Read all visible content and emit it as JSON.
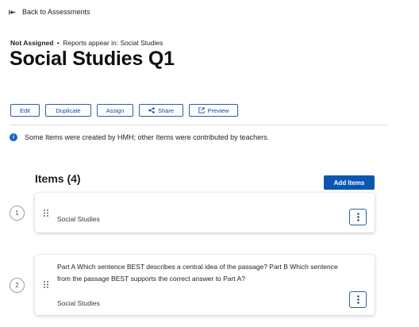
{
  "nav": {
    "back_label": "Back to Assessments"
  },
  "header": {
    "status": "Not Assigned",
    "separator": "•",
    "reports_text": "Reports appear in: Social Studies",
    "title": "Social Studies Q1"
  },
  "toolbar": {
    "edit": "Edit",
    "duplicate": "Duplicate",
    "assign": "Assign",
    "share": "Share",
    "preview": "Preview"
  },
  "notice": {
    "icon": "info-icon",
    "text": "Some Items were created by HMH; other Items were contributed by teachers."
  },
  "items_section": {
    "heading": "Items (4)",
    "add_label": "Add Items",
    "items": [
      {
        "number": "1",
        "text": "",
        "subject": "Social Studies"
      },
      {
        "number": "2",
        "text": "Part A Which sentence BEST describes a central idea of the passage? Part B Which sentence from the passage BEST supports the correct answer to Part A?",
        "subject": "Social Studies"
      }
    ]
  },
  "colors": {
    "accent": "#0b56b3",
    "outline": "#2b5ea8",
    "info": "#1565c0"
  }
}
